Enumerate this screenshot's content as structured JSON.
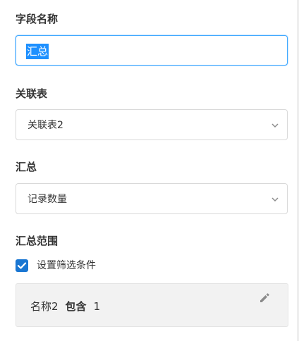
{
  "field_name": {
    "label": "字段名称",
    "value": "汇总"
  },
  "related_table": {
    "label": "关联表",
    "selected": "关联表2"
  },
  "summary": {
    "label": "汇总",
    "selected": "记录数量"
  },
  "summary_scope": {
    "label": "汇总范围",
    "checkbox_label": "设置筛选条件",
    "checkbox_checked": true,
    "filter": {
      "field": "名称2",
      "operator": "包含",
      "value": "1"
    }
  },
  "colors": {
    "accent": "#1976d2",
    "selection": "#1e90ff",
    "focus_border": "#40a9ff"
  }
}
